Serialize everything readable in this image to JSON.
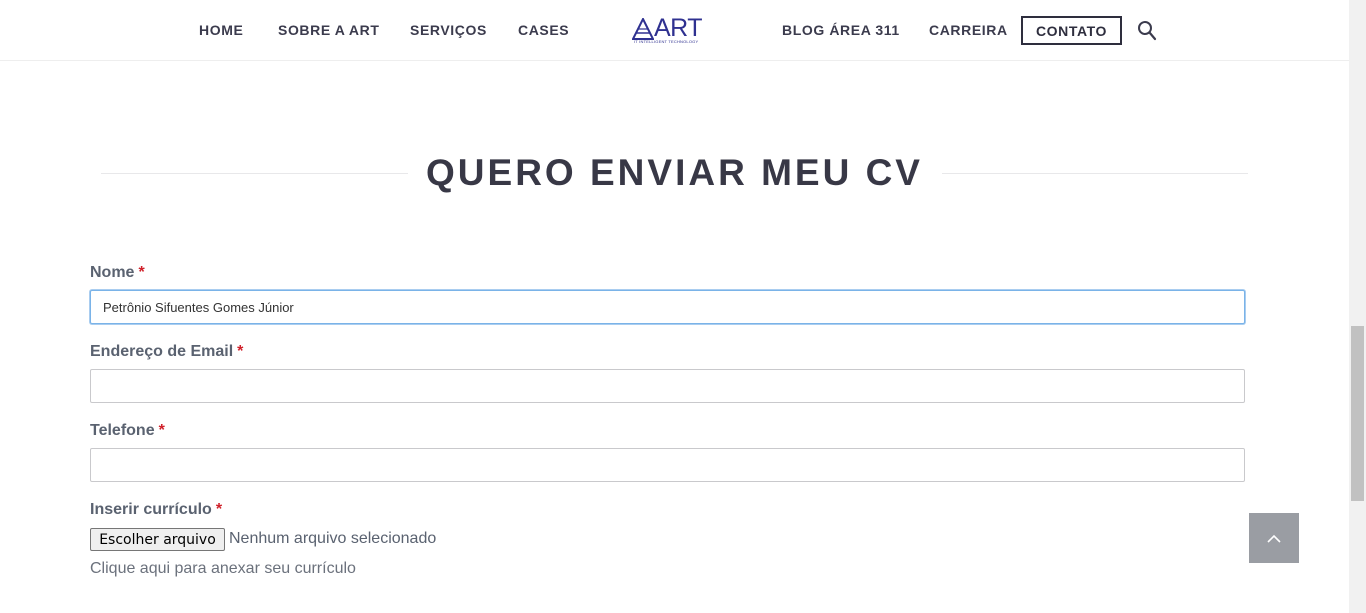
{
  "nav": {
    "home": "HOME",
    "sobre": "SOBRE A ART",
    "servicos": "SERVIÇOS",
    "cases": "CASES",
    "blog": "BLOG ÁREA 311",
    "carreira": "CARREIRA",
    "contato": "CONTATO",
    "search_icon": "search-icon"
  },
  "logo": {
    "word": "ART",
    "tagline": "IT INTELLIGENT TECHNOLOGY",
    "color": "#2f3190"
  },
  "section": {
    "title": "QUERO ENVIAR MEU CV"
  },
  "form": {
    "required_mark": "*",
    "nome": {
      "label": "Nome",
      "value": "Petrônio Sifuentes Gomes Júnior"
    },
    "email": {
      "label": "Endereço de Email",
      "value": ""
    },
    "telefone": {
      "label": "Telefone",
      "value": ""
    },
    "curriculo": {
      "label": "Inserir currículo",
      "button": "Escolher arquivo",
      "status": "Nenhum arquivo selecionado",
      "hint": "Clique aqui para anexar seu currículo"
    }
  },
  "back_to_top_icon": "chevron-up-icon"
}
